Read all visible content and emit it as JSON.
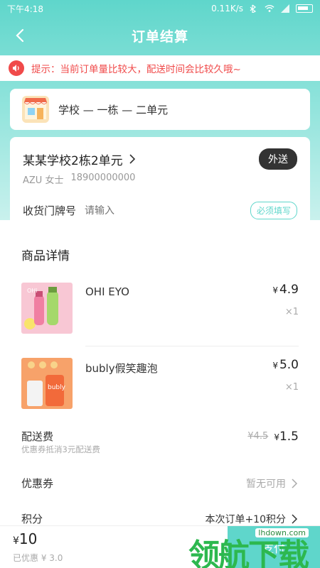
{
  "status_bar": {
    "time": "下午4:18",
    "network_speed": "0.11K/s"
  },
  "nav": {
    "title": "订单结算"
  },
  "notice": {
    "text": "提示：当前订单量比较大，配送时间会比较久哦~"
  },
  "shop": {
    "name": "学校 — 一栋 — 二单元"
  },
  "address": {
    "title": "某某学校2栋2单元",
    "contact_name": "AZU 女士",
    "contact_phone": "18900000000",
    "delivery_mode": "外送",
    "doorplate_label": "收货门牌号",
    "doorplate_placeholder": "请输入",
    "required_tag": "必须填写"
  },
  "goods": {
    "section_title": "商品详情",
    "currency": "¥",
    "items": [
      {
        "name": "OHI EYO",
        "price": "4.9",
        "qty": "×1"
      },
      {
        "name": "bubly假笑趣泡",
        "price": "5.0",
        "qty": "×1"
      }
    ]
  },
  "delivery_fee": {
    "label": "配送费",
    "original": "¥4.5",
    "current": "1.5",
    "note": "优惠券抵消3元配送费"
  },
  "coupon": {
    "label": "优惠券",
    "value": "暂无可用"
  },
  "points": {
    "label": "积分",
    "value": "本次订单+10积分"
  },
  "footer": {
    "total": "10",
    "saved": "已优惠 ¥ 3.0",
    "pay_label": "支付"
  },
  "watermark": {
    "text": "领航下载",
    "url": "lhdown.com"
  },
  "colors": {
    "accent": "#5fd6cb",
    "warning": "#f04a4a"
  }
}
